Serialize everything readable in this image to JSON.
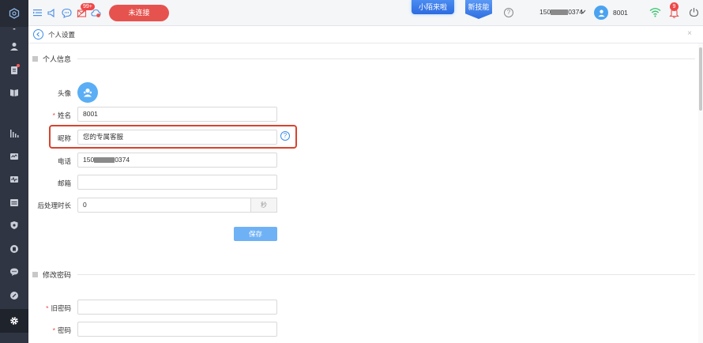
{
  "topbar": {
    "badge_count": "99+",
    "disconnect_label": "未连接",
    "promo1": "小陌来啦",
    "promo2": "新技能",
    "help": "?",
    "phone_prefix": "150",
    "phone_suffix": "0374",
    "user_name": "8001",
    "bell_count": "9"
  },
  "tab": {
    "title": "个人设置",
    "close": "×"
  },
  "section_personal": {
    "title": "个人信息"
  },
  "section_password": {
    "title": "修改密码"
  },
  "form": {
    "avatar_label": "头像",
    "name_label": "姓名",
    "name_value": "8001",
    "nickname_label": "昵称",
    "nickname_value": "您的专属客服",
    "phone_label": "电话",
    "phone_prefix": "150",
    "phone_suffix": "0374",
    "email_label": "邮箱",
    "email_value": "",
    "after_label": "后处理时长",
    "after_value": "0",
    "after_unit": "秒",
    "save_label": "保存",
    "required_mark": "*"
  },
  "password_form": {
    "old_label": "旧密码",
    "new_label": "密码"
  },
  "colors": {
    "sidebar": "#2f3542",
    "accent": "#3a8ee6",
    "danger": "#e6534f",
    "highlight": "#d8432f"
  }
}
